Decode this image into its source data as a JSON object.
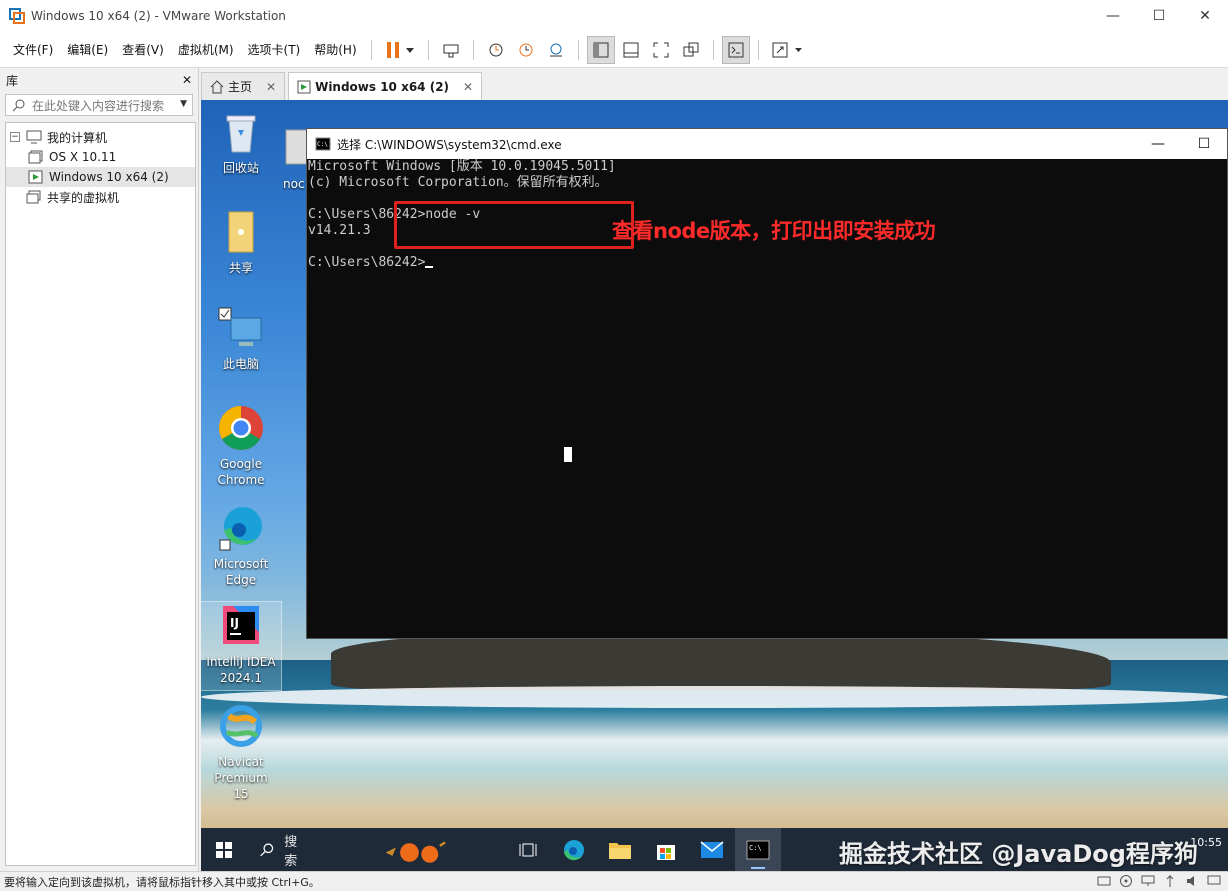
{
  "window": {
    "title": "Windows 10 x64 (2) - VMware Workstation",
    "minimize": "—",
    "maximize": "☐",
    "close": "✕"
  },
  "menu": [
    "文件(F)",
    "编辑(E)",
    "查看(V)",
    "虚拟机(M)",
    "选项卡(T)",
    "帮助(H)"
  ],
  "library": {
    "title": "库",
    "close": "✕",
    "search_placeholder": "在此处键入内容进行搜索",
    "tree": {
      "root": "我的计算机",
      "children": [
        "OS X 10.11",
        "Windows 10 x64 (2)"
      ],
      "shared": "共享的虚拟机"
    }
  },
  "tabs": {
    "home": "主页",
    "vm": "Windows 10 x64 (2)",
    "close": "✕"
  },
  "desktop": {
    "icons": [
      "回收站",
      "共享",
      "此电脑",
      "Google Chrome",
      "Microsoft Edge",
      "IntelliJ IDEA 2024.1",
      "Navicat Premium 15"
    ],
    "partial_icon": "noc"
  },
  "cmd": {
    "title": "选择 C:\\WINDOWS\\system32\\cmd.exe",
    "lines": [
      "Microsoft Windows [版本 10.0.19045.5011]",
      "(c) Microsoft Corporation。保留所有权利。",
      "",
      "C:\\Users\\86242>node -v",
      "v14.21.3",
      "",
      "C:\\Users\\86242>"
    ],
    "annotation": "查看node版本，打印出即安装成功"
  },
  "taskbar": {
    "search": "搜索",
    "clock_time": "10:55",
    "watermark": "掘金技术社区 @JavaDog程序狗"
  },
  "statusbar": {
    "text": "要将输入定向到该虚拟机，请将鼠标指针移入其中或按 Ctrl+G。"
  },
  "colors": {
    "annotation_red": "#e0221f",
    "pause_orange": "#e8731c",
    "taskbar": "#1f2a38"
  }
}
